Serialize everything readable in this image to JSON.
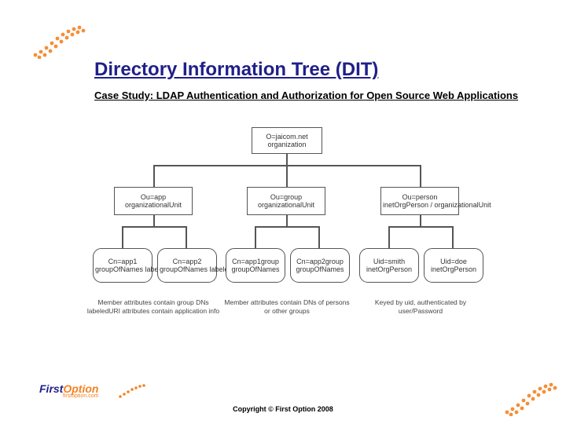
{
  "title": "Directory Information Tree (DIT)",
  "subtitle": "Case Study: LDAP Authentication and Authorization for Open Source Web Applications",
  "footer": "Copyright © First Option 2008",
  "logo": {
    "first": "First",
    "option": "Option",
    "sub": "firstoption.com"
  },
  "tree": {
    "root": {
      "line1": "O=jaicom.net",
      "line2": "organization"
    },
    "level2": [
      {
        "key": "app",
        "line1": "Ou=app",
        "line2": "organizationalUnit"
      },
      {
        "key": "group",
        "line1": "Ou=group",
        "line2": "organizationalUnit"
      },
      {
        "key": "person",
        "line1": "Ou=person",
        "line2": "inetOrgPerson / organizationalUnit"
      }
    ],
    "leaves": [
      {
        "parent": "app",
        "line1": "Cn=app1",
        "line2": "groupOfNames labeledURI"
      },
      {
        "parent": "app",
        "line1": "Cn=app2",
        "line2": "groupOfNames labeledURI"
      },
      {
        "parent": "group",
        "line1": "Cn=app1group",
        "line2": "groupOfNames"
      },
      {
        "parent": "group",
        "line1": "Cn=app2group",
        "line2": "groupOfNames"
      },
      {
        "parent": "person",
        "line1": "Uid=smith",
        "line2": "inetOrgPerson"
      },
      {
        "parent": "person",
        "line1": "Uid=doe",
        "line2": "inetOrgPerson"
      }
    ]
  },
  "captions": {
    "left": "Member attributes contain group DNs\nlabeledURI attributes contain application info",
    "center": "Member attributes contain DNs of persons or other groups",
    "right": "Keyed by uid, authenticated by user/Password"
  }
}
